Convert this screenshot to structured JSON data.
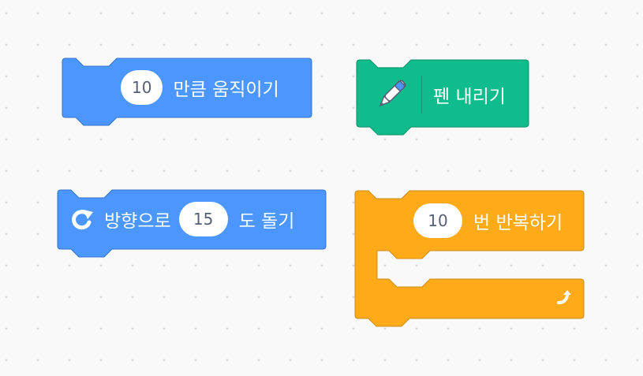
{
  "blocks": {
    "move": {
      "value": "10",
      "label": "만큼 움직이기",
      "color": "#4c97ff",
      "border": "#3373cc"
    },
    "pen_down": {
      "label": "펜 내리기",
      "color": "#0fbd8c",
      "border": "#0b8e69",
      "icon": "pen-icon"
    },
    "turn": {
      "prefix": "방향으로",
      "value": "15",
      "suffix": "도 돌기",
      "color": "#4c97ff",
      "border": "#3373cc",
      "icon": "turn-right-icon"
    },
    "repeat": {
      "value": "10",
      "label": "번 반복하기",
      "color": "#ffab19",
      "border": "#cf8b17",
      "icon": "repeat-arrow-icon"
    }
  }
}
